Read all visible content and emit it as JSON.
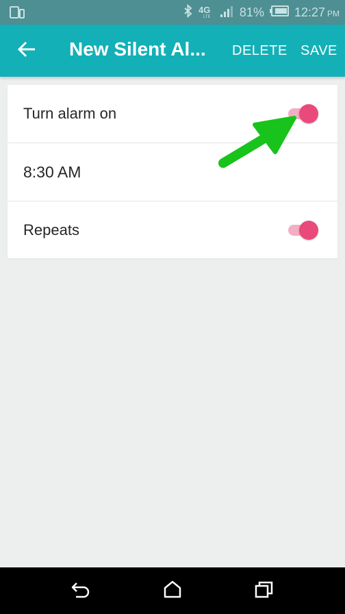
{
  "status_bar": {
    "network": "4G LTE",
    "battery": "81%",
    "time": "12:27",
    "ampm": "PM",
    "icons": [
      "phone-outline-icon",
      "bluetooth-icon",
      "4g-lte-icon",
      "signal-icon",
      "battery-icon"
    ]
  },
  "app_bar": {
    "title": "New Silent Al...",
    "delete_label": "DELETE",
    "save_label": "SAVE",
    "background": "#13b0b7"
  },
  "settings": {
    "alarm_on": {
      "label": "Turn alarm on",
      "enabled": true
    },
    "time": {
      "value": "8:30 AM"
    },
    "repeats": {
      "label": "Repeats",
      "enabled": true
    }
  },
  "colors": {
    "accent": "#ea4a7b",
    "toggle_track": "#f4aec4",
    "annotation": "#18c31b",
    "status_bar": "#4d8f92"
  },
  "nav_bar": {
    "icons": [
      "back-icon",
      "home-icon",
      "recents-icon"
    ]
  }
}
